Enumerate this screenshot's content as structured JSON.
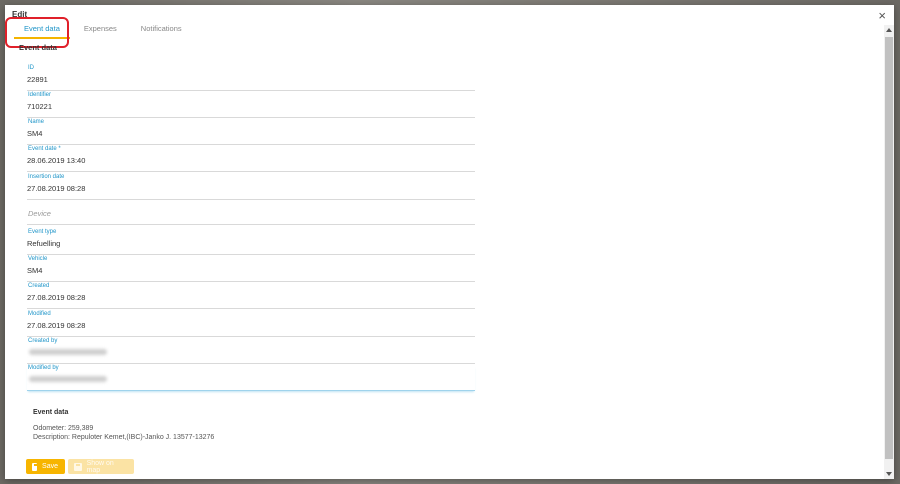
{
  "dialog": {
    "title": "Edit",
    "close_glyph": "×"
  },
  "tabs": [
    {
      "label": "Event data",
      "active": true
    },
    {
      "label": "Expenses",
      "active": false
    },
    {
      "label": "Notifications",
      "active": false
    }
  ],
  "section_heading": "Event data",
  "fields": {
    "id": {
      "label": "ID",
      "value": "22891"
    },
    "identifier": {
      "label": "Identifier",
      "value": "710221"
    },
    "name": {
      "label": "Name",
      "value": "SM4"
    },
    "event_date": {
      "label": "Event date *",
      "value": "28.06.2019 13:40"
    },
    "insertion_date": {
      "label": "Insertion date",
      "value": "27.08.2019 08:28"
    },
    "device": {
      "placeholder": "Device"
    },
    "event_type": {
      "label": "Event type",
      "value": "Refuelling"
    },
    "vehicle": {
      "label": "Vehicle",
      "value": "SM4"
    },
    "created": {
      "label": "Created",
      "value": "27.08.2019 08:28"
    },
    "modified": {
      "label": "Modified",
      "value": "27.08.2019 08:28"
    },
    "created_by": {
      "label": "Created by"
    },
    "modified_by": {
      "label": "Modified by"
    }
  },
  "event_info": {
    "title": "Event data",
    "odometer": "Odometer: 259,389",
    "description": "Description: Repuloter Kemet,(IBC)-Janko J. 13577-13276"
  },
  "actions": {
    "save_label": "Save",
    "show_on_map_label": "Show on map"
  },
  "colors": {
    "accent": "#2196c9",
    "primary_button": "#f7b500",
    "highlight": "#e0202a"
  }
}
